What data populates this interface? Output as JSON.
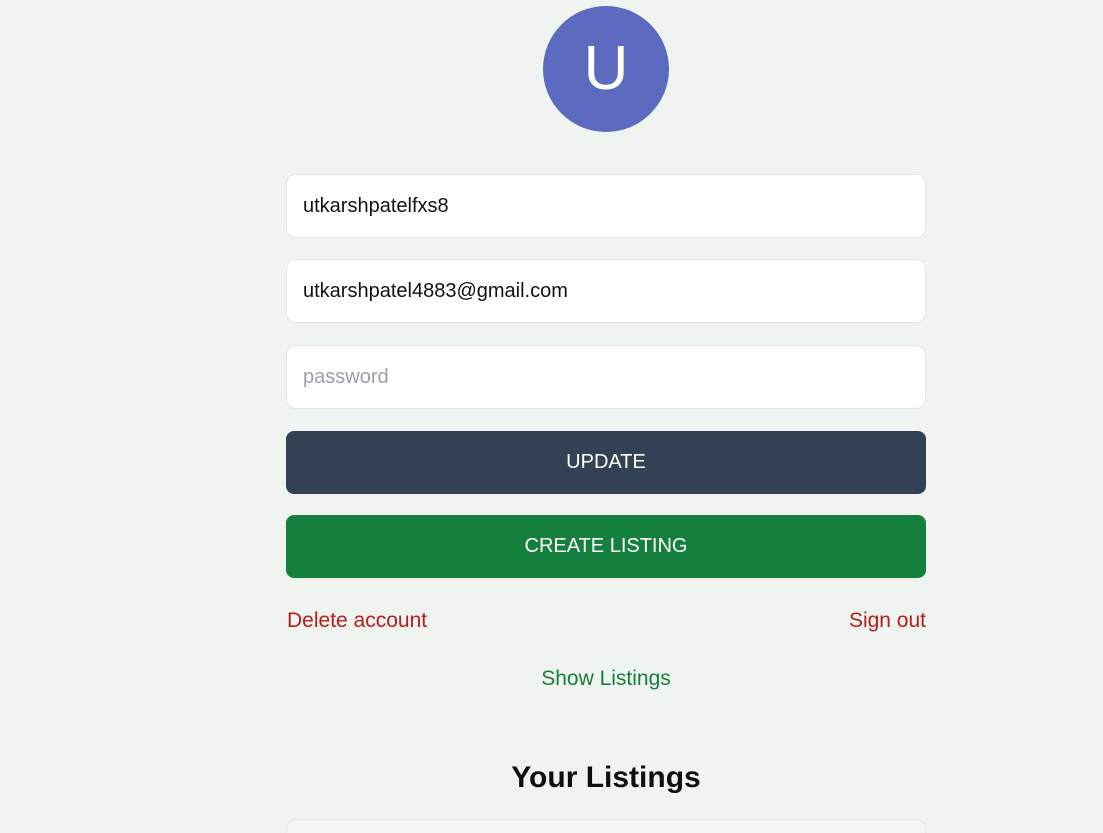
{
  "avatar": {
    "initial": "U",
    "color": "#5c6bc0"
  },
  "form": {
    "username_value": "utkarshpatelfxs8",
    "email_value": "utkarshpatel4883@gmail.com",
    "password_placeholder": "password"
  },
  "buttons": {
    "update_label": "UPDATE",
    "update_color": "#334155",
    "create_listing_label": "CREATE LISTING",
    "create_listing_color": "#15803d"
  },
  "links": {
    "delete_account": "Delete account",
    "sign_out": "Sign out",
    "show_listings": "Show Listings",
    "danger_color": "#b91c1c",
    "success_color": "#15803d"
  },
  "listings": {
    "heading": "Your Listings"
  }
}
